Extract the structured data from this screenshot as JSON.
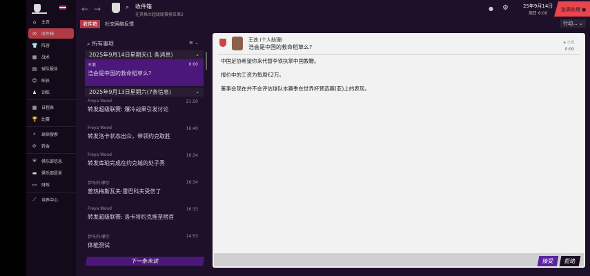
{
  "sidebar": {
    "items": [
      {
        "label": "主页",
        "icon": "home-icon"
      },
      {
        "label": "收件箱",
        "icon": "inbox-icon"
      },
      {
        "label": "阵容",
        "icon": "shirt-icon"
      },
      {
        "label": "战术",
        "icon": "tactics-icon"
      },
      {
        "label": "球队报告",
        "icon": "report-icon"
      },
      {
        "label": "职员",
        "icon": "staff-icon"
      },
      {
        "label": "训练",
        "icon": "training-icon"
      },
      {
        "label": "日程表",
        "icon": "calendar-icon"
      },
      {
        "label": "比赛",
        "icon": "trophy-icon"
      },
      {
        "label": "球探搜索",
        "icon": "search-icon"
      },
      {
        "label": "转会",
        "icon": "transfer-icon"
      },
      {
        "label": "俱乐部信息",
        "icon": "shield-icon"
      },
      {
        "label": "俱乐部愿景",
        "icon": "briefcase-icon"
      },
      {
        "label": "财政",
        "icon": "money-icon"
      },
      {
        "label": "培养中心",
        "icon": "development-icon"
      }
    ]
  },
  "header": {
    "title": "收件箱",
    "subtitle": "在英格兰超级联赛排名第2",
    "tabs": [
      "收件箱",
      "社交网络反馈"
    ],
    "date": "25年9月14日",
    "day_time": "周日 6:00",
    "urgent": "急需处理",
    "actions": "行动..."
  },
  "list": {
    "search_placeholder": "所有事项",
    "groups": [
      {
        "label": "2025年9月14日星期天(1 条消息)"
      },
      {
        "label": "2025年9月13日星期六(7条信息)"
      }
    ],
    "items": [
      {
        "from": "王浪",
        "subject": "浩会是中国的救命稻草么?",
        "time": "0:00"
      },
      {
        "from": "Freya Wood",
        "subject": "转发超级联赛: 爆冷战果引发讨论",
        "time": "21:50"
      },
      {
        "from": "Freya Wood",
        "subject": "转发洛卡状态出众，带领约克取胜",
        "time": "16:40"
      },
      {
        "from": "Freya Wood",
        "subject": "转发库珀完成在约克城的处子秀",
        "time": "16:34"
      },
      {
        "from": "伊冯内·摩尔",
        "subject": "普热梅斯瓦夫·雷巴科夫受伤了",
        "time": "16:34"
      },
      {
        "from": "Freya Wood",
        "subject": "转发超级联赛: 洛卡将约克推至榜首",
        "time": "16:33"
      },
      {
        "from": "伊冯内·摩尔",
        "subject": "体能测试",
        "time": "14:53"
      }
    ],
    "next_unread": "下一条未读"
  },
  "message": {
    "sender": "王浪 (个人助理)",
    "subject": "浩会是中国的救命稻草么?",
    "status": "已阅",
    "time": "0:00",
    "body": [
      "中国足协希望你来代替李铁执掌中国教鞭。",
      "报价中的工资为每周€2万。",
      "董事会现在并不会评估球队本赛季在世界杯预选赛(亚)上的表现。"
    ],
    "accept": "接受",
    "reject": "拒绝"
  },
  "colors": {
    "accent": "#b23a45",
    "purple": "#4c177a",
    "urgent": "#e8454f"
  }
}
